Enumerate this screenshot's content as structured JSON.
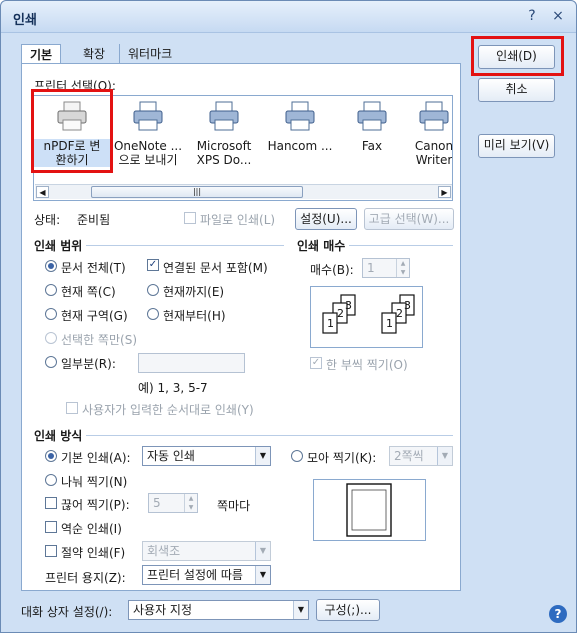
{
  "window": {
    "title": "인쇄",
    "help_glyph": "?",
    "close_glyph": "×"
  },
  "tabs": [
    {
      "label": "기본"
    },
    {
      "label": "확장"
    },
    {
      "label": "워터마크"
    }
  ],
  "printer_select": {
    "label": "프린터 선택(O):",
    "printers": [
      {
        "line1": "nPDF로 변",
        "line2": "환하기"
      },
      {
        "line1": "OneNote ...",
        "line2": "으로 보내기"
      },
      {
        "line1": "Microsoft",
        "line2": "XPS Do..."
      },
      {
        "line1": "Hancom ...",
        "line2": ""
      },
      {
        "line1": "Fax",
        "line2": ""
      },
      {
        "line1": "Canon",
        "line2": "Writer"
      }
    ],
    "scroll_thumb": "|||"
  },
  "status": {
    "label": "상태:",
    "value": "준비됨",
    "print_to_file": "파일로 인쇄(L)",
    "setup_button": "설정(U)...",
    "advanced_button": "고급 선택(W)..."
  },
  "print_range": {
    "title": "인쇄 범위",
    "all_document": "문서 전체(T)",
    "include_linked": "연결된 문서 포함(M)",
    "current_page": "현재 쪽(C)",
    "up_to_current": "현재까지(E)",
    "current_section": "현재 구역(G)",
    "from_current": "현재부터(H)",
    "selected_pages": "선택한 쪽만(S)",
    "partial": "일부분(R):",
    "example": "예) 1, 3, 5-7",
    "user_order": "사용자가 입력한 순서대로 인쇄(Y)"
  },
  "copies": {
    "title": "인쇄 매수",
    "label": "매수(B):",
    "value": "1",
    "collate": "한 부씩 찍기(O)",
    "page_nums": [
      "1",
      "2",
      "3"
    ]
  },
  "print_method": {
    "title": "인쇄 방식",
    "basic": "기본 인쇄(A):",
    "basic_value": "자동 인쇄",
    "divide": "나눠 찍기(N)",
    "cut": "끊어 찍기(P):",
    "cut_value": "5",
    "per_page": "쪽마다",
    "reverse": "역순 인쇄(I)",
    "save": "절약 인쇄(F)",
    "save_value": "회색조",
    "paper": "프린터 용지(Z):",
    "paper_value": "프린터 설정에 따름",
    "nup": "모아 찍기(K):",
    "nup_value": "2쪽씩"
  },
  "buttons": {
    "print": "인쇄(D)",
    "cancel": "취소",
    "preview": "미리 보기(V)"
  },
  "footer": {
    "dialog_setting_label": "대화 상자 설정(/):",
    "dialog_setting_value": "사용자 지정",
    "configure_button": "구성(;)...",
    "help_glyph": "?"
  }
}
